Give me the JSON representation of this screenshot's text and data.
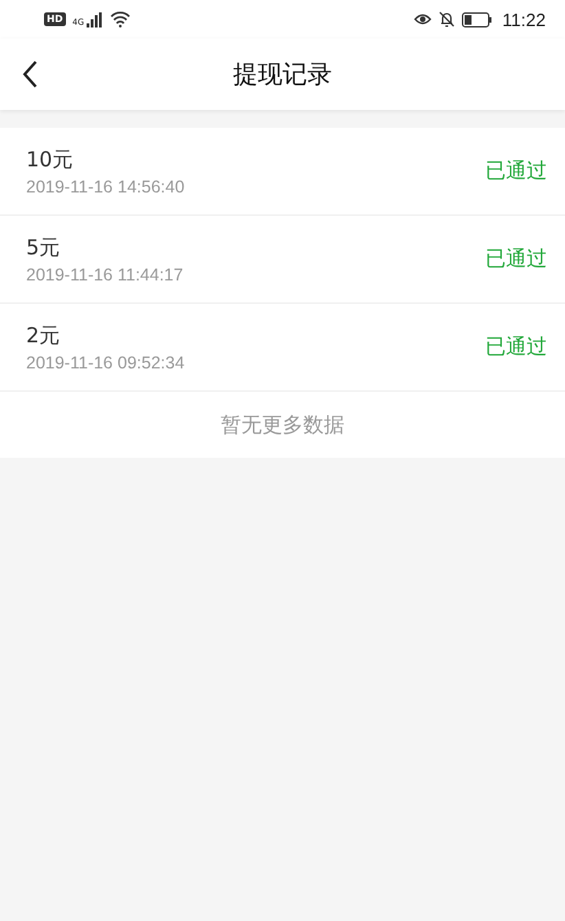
{
  "status_bar": {
    "hd_badge": "HD",
    "network": "4G",
    "time": "11:22"
  },
  "header": {
    "title": "提现记录"
  },
  "records": [
    {
      "amount": "10元",
      "time": "2019-11-16 14:56:40",
      "status": "已通过"
    },
    {
      "amount": "5元",
      "time": "2019-11-16 11:44:17",
      "status": "已通过"
    },
    {
      "amount": "2元",
      "time": "2019-11-16 09:52:34",
      "status": "已通过"
    }
  ],
  "footer": {
    "text": "暂无更多数据"
  }
}
